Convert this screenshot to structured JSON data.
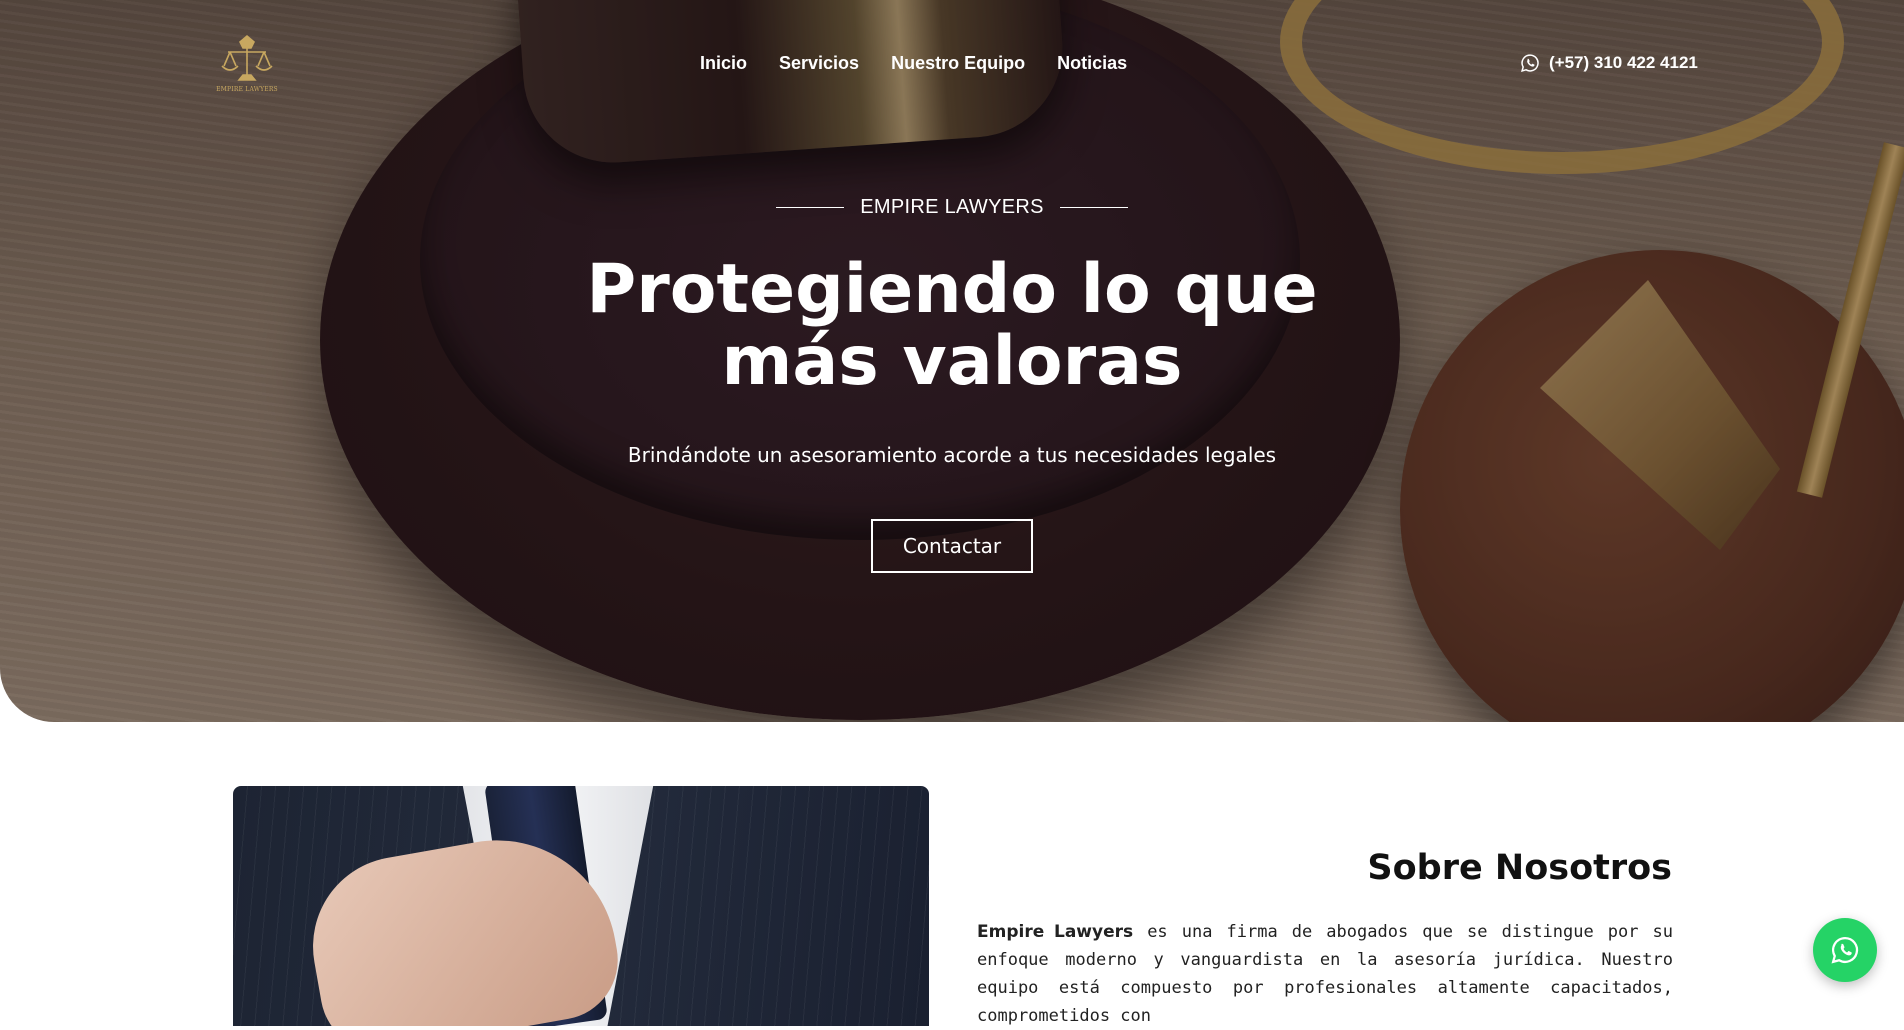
{
  "brand": {
    "logo_text": "EMPIRE LAWYERS"
  },
  "nav": {
    "items": [
      "Inicio",
      "Servicios",
      "Nuestro Equipo",
      "Noticias"
    ]
  },
  "header": {
    "phone": "(+57) 310 422 4121"
  },
  "hero": {
    "kicker": "EMPIRE LAWYERS",
    "title_line1": "Protegiendo lo que",
    "title_line2": "más valoras",
    "subtitle": "Brindándote un asesoramiento acorde a tus necesidades legales",
    "cta_label": "Contactar"
  },
  "about": {
    "title": "Sobre Nosotros",
    "firm_name": "Empire Lawyers",
    "text": " es una firma de abogados que se distingue por su enfoque moderno y vanguardista en la asesoría jurídica. Nuestro equipo está compuesto por profesionales altamente capacitados, comprometidos con"
  },
  "colors": {
    "accent_gold": "#c8a860",
    "whatsapp_green": "#25d366"
  },
  "icons": {
    "phone": "whatsapp-icon",
    "floating": "whatsapp-icon"
  }
}
